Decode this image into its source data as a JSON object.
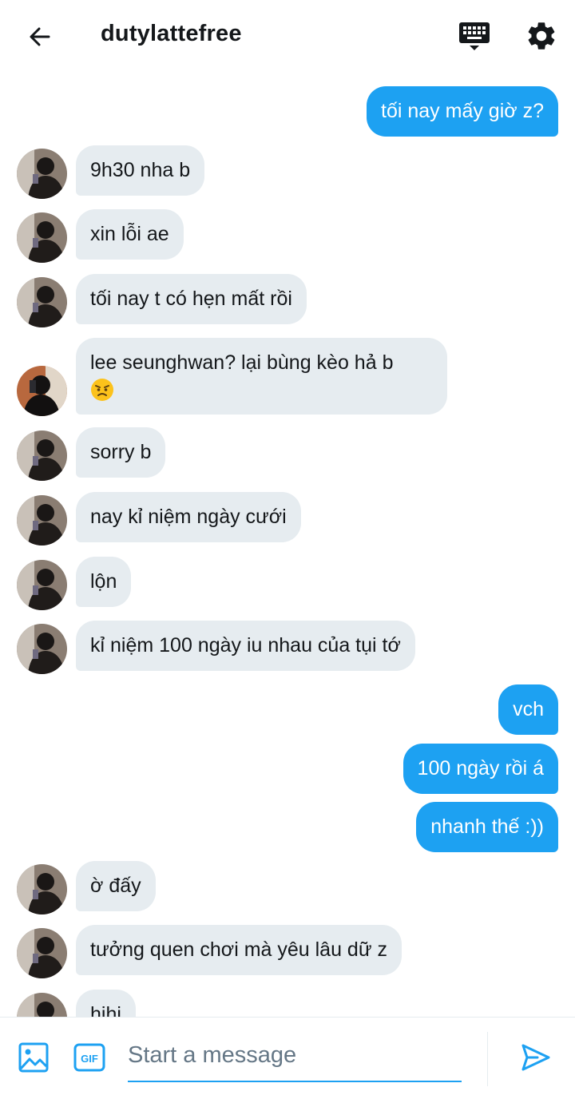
{
  "header": {
    "title": "dutylattefree",
    "colors": {
      "accent": "#1da1f2",
      "text": "#14171a"
    },
    "icons": [
      "back-arrow-icon",
      "keyboard-icon",
      "gear-icon"
    ]
  },
  "messages": [
    {
      "dir": "out",
      "text": "tối nay mấy giờ z?"
    },
    {
      "dir": "in",
      "text": "9h30 nha b"
    },
    {
      "dir": "in",
      "text": "xin lỗi ae"
    },
    {
      "dir": "in",
      "text": "tối nay t có hẹn mất rồi"
    },
    {
      "dir": "in",
      "text": "lee seunghwan? lại bùng kèo hả b",
      "emoji": "angry-face-emoji"
    },
    {
      "dir": "in",
      "text": "sorry b"
    },
    {
      "dir": "in",
      "text": "nay kỉ niệm ngày cưới"
    },
    {
      "dir": "in",
      "text": "lộn"
    },
    {
      "dir": "in",
      "text": "kỉ niệm 100 ngày iu nhau của tụi tớ"
    },
    {
      "dir": "out",
      "text": "vch"
    },
    {
      "dir": "out",
      "text": "100 ngày rồi á"
    },
    {
      "dir": "out",
      "text": "nhanh thế :))"
    },
    {
      "dir": "in",
      "text": "ờ đấy"
    },
    {
      "dir": "in",
      "text": "tưởng quen chơi mà yêu lâu dữ z"
    },
    {
      "dir": "in",
      "text": "hihi"
    }
  ],
  "composer": {
    "placeholder": "Start a message",
    "gif_label": "GIF",
    "icons": [
      "image-icon",
      "gif-icon",
      "send-icon"
    ]
  }
}
